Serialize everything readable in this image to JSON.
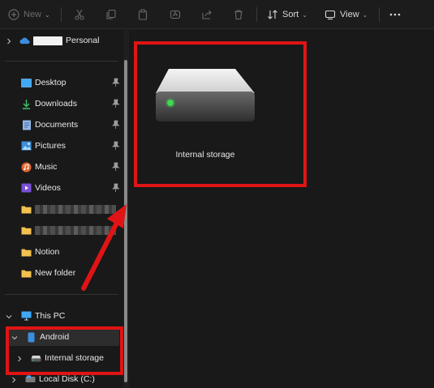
{
  "toolbar": {
    "new_label": "New",
    "sort_label": "Sort",
    "view_label": "View"
  },
  "sidebar": {
    "onedrive": {
      "label": "Personal"
    },
    "quick_access": [
      {
        "label": "Desktop",
        "icon": "desktop-icon",
        "pinned": true
      },
      {
        "label": "Downloads",
        "icon": "download-icon",
        "pinned": true
      },
      {
        "label": "Documents",
        "icon": "documents-icon",
        "pinned": true
      },
      {
        "label": "Pictures",
        "icon": "pictures-icon",
        "pinned": true
      },
      {
        "label": "Music",
        "icon": "music-icon",
        "pinned": true
      },
      {
        "label": "Videos",
        "icon": "videos-icon",
        "pinned": true
      }
    ],
    "folders": [
      {
        "label": "Notion"
      },
      {
        "label": "New folder"
      }
    ],
    "this_pc": {
      "label": "This PC"
    },
    "android": {
      "label": "Android"
    },
    "internal_storage": {
      "label": "Internal storage"
    },
    "local_disk": {
      "label": "Local Disk (C:)"
    }
  },
  "content": {
    "items": [
      {
        "label": "Internal storage",
        "icon": "drive-icon"
      }
    ]
  },
  "colors": {
    "background": "#191919",
    "highlight": "#e01414",
    "accent": "#4aa3ff"
  }
}
